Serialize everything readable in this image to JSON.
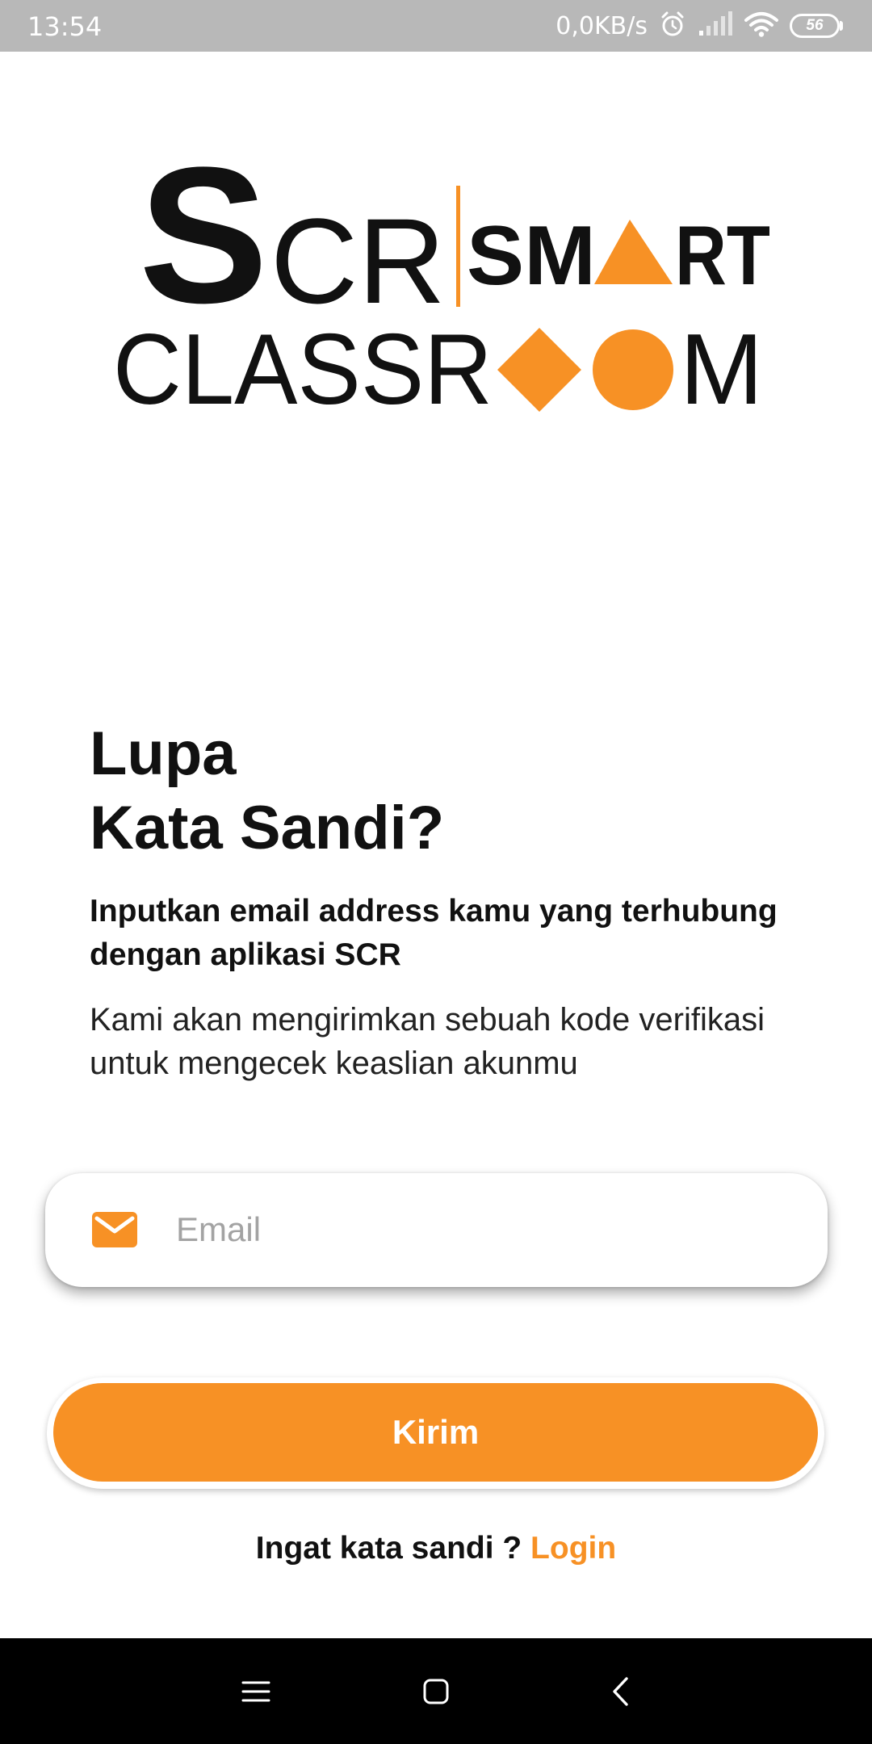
{
  "status_bar": {
    "time": "13:54",
    "network_speed": "0,0KB/s",
    "battery_level": "56",
    "icons": [
      "alarm-icon",
      "signal-icon",
      "wifi-icon",
      "battery-icon"
    ]
  },
  "logo": {
    "scr": "SCR",
    "smart": "SMART",
    "classroom": "CLASSROOM"
  },
  "form": {
    "title_line1": "Lupa",
    "title_line2": "Kata Sandi?",
    "subtitle": "Inputkan email address kamu yang terhubung dengan aplikasi SCR",
    "description": "Kami akan mengirimkan sebuah kode verifikasi untuk mengecek keaslian akunmu",
    "email_placeholder": "Email",
    "email_value": "",
    "email_icon": "mail-icon",
    "submit_label": "Kirim",
    "remember_text": "Ingat kata sandi ?",
    "login_label": "Login"
  },
  "nav_bar": {
    "buttons": [
      "menu-icon",
      "home-icon",
      "back-icon"
    ]
  },
  "colors": {
    "accent": "#f79125",
    "status_bar": "#b8b8b8",
    "nav_bar": "#000000",
    "text": "#111111"
  }
}
